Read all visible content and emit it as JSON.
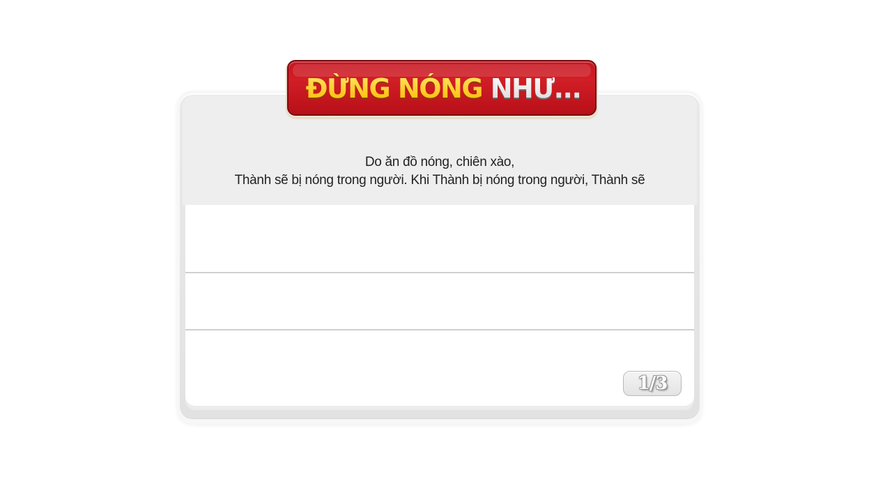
{
  "banner": {
    "title_highlight": "ĐỪNG NÓNG",
    "title_rest": " NHƯ..."
  },
  "question": {
    "line1": "Do ăn đồ nóng, chiên xào,",
    "line2": "Thành sẽ bị nóng trong người. Khi Thành bị nóng trong người, Thành sẽ"
  },
  "answers": [
    {
      "label": ""
    },
    {
      "label": ""
    },
    {
      "label": ""
    }
  ],
  "progress": {
    "text": "1/3",
    "current": 1,
    "total": 3
  },
  "colors": {
    "banner_red": "#c5151f",
    "banner_yellow": "#ffd21f",
    "card_grey": "#eeeeee"
  }
}
